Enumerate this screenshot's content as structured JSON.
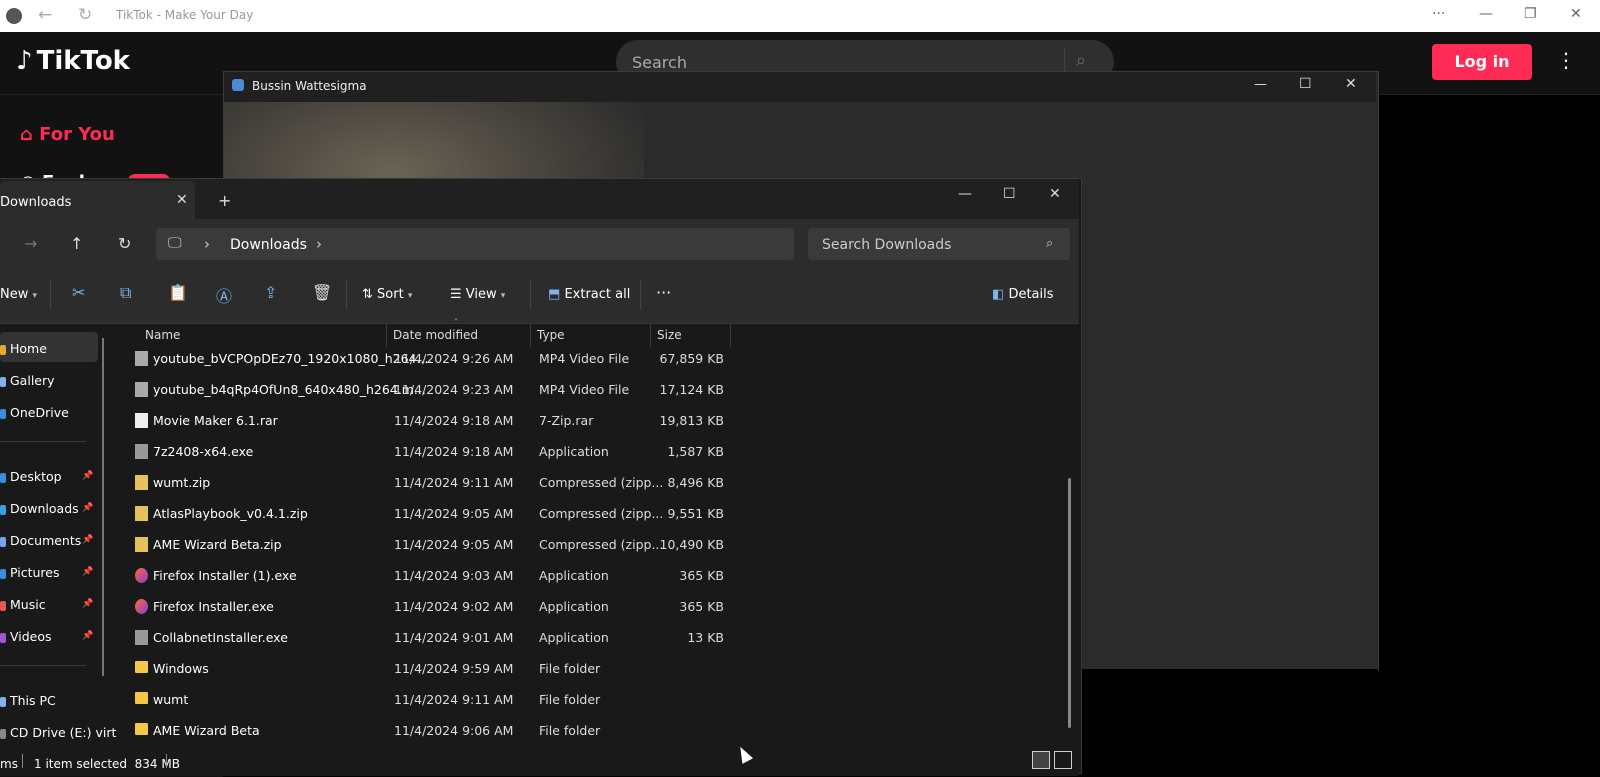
{
  "browser": {
    "title": "TikTok - Make Your Day",
    "logo_icon": "tiktok-icon",
    "back_icon": "back-arrow-icon",
    "reload_icon": "reload-icon",
    "more": "···",
    "minimize": "—",
    "restore": "❐",
    "close": "✕"
  },
  "tiktok": {
    "logo": "TikTok",
    "search_placeholder": "Search",
    "login": "Log in",
    "more": "⋮",
    "sidebar": {
      "for_you": "For You",
      "explore": "Explore"
    },
    "accent": "#fe2c55"
  },
  "video_window": {
    "title": "Bussin Wattesigma",
    "minimize": "—",
    "maximize": "☐",
    "close": "✕"
  },
  "explorer": {
    "tab_label": "Downloads",
    "tab_close": "✕",
    "tab_add": "+",
    "minimize": "—",
    "maximize": "☐",
    "close": "✕",
    "nav": {
      "forward": "→",
      "up": "↑",
      "refresh": "↻"
    },
    "address": {
      "computer_icon": "🖵",
      "sep1": "›",
      "folder": "Downloads",
      "sep2": "›"
    },
    "search_placeholder": "Search Downloads",
    "toolbar": {
      "new": "New",
      "sort": "Sort",
      "view": "View",
      "extract_all": "Extract all",
      "more": "···",
      "details": "Details"
    },
    "nav_pane": [
      {
        "label": "Home",
        "pinned": false
      },
      {
        "label": "Gallery",
        "pinned": false
      },
      {
        "label": "OneDrive",
        "pinned": false
      },
      {
        "label": "Desktop",
        "pinned": true
      },
      {
        "label": "Downloads",
        "pinned": true
      },
      {
        "label": "Documents",
        "pinned": true
      },
      {
        "label": "Pictures",
        "pinned": true
      },
      {
        "label": "Music",
        "pinned": true
      },
      {
        "label": "Videos",
        "pinned": true
      },
      {
        "label": "This PC",
        "pinned": false
      },
      {
        "label": "CD Drive (E:) virt",
        "pinned": false
      }
    ],
    "columns": {
      "name": "Name",
      "date": "Date modified",
      "type": "Type",
      "size": "Size"
    },
    "files": [
      {
        "name": "youtube_bVCPOpDEz70_1920x1080_h264....",
        "date": "11/4/2024 9:26 AM",
        "type": "MP4 Video File",
        "size": "67,859 KB",
        "icon": "vid"
      },
      {
        "name": "youtube_b4qRp4OfUn8_640x480_h264.m...",
        "date": "11/4/2024 9:23 AM",
        "type": "MP4 Video File",
        "size": "17,124 KB",
        "icon": "vid"
      },
      {
        "name": "Movie Maker 6.1.rar",
        "date": "11/4/2024 9:18 AM",
        "type": "7-Zip.rar",
        "size": "19,813 KB",
        "icon": "file"
      },
      {
        "name": "7z2408-x64.exe",
        "date": "11/4/2024 9:18 AM",
        "type": "Application",
        "size": "1,587 KB",
        "icon": "app"
      },
      {
        "name": "wumt.zip",
        "date": "11/4/2024 9:11 AM",
        "type": "Compressed (zipp...",
        "size": "8,496 KB",
        "icon": "zip"
      },
      {
        "name": "AtlasPlaybook_v0.4.1.zip",
        "date": "11/4/2024 9:05 AM",
        "type": "Compressed (zipp...",
        "size": "9,551 KB",
        "icon": "zip"
      },
      {
        "name": "AME Wizard Beta.zip",
        "date": "11/4/2024 9:05 AM",
        "type": "Compressed (zipp...",
        "size": "10,490 KB",
        "icon": "zip"
      },
      {
        "name": "Firefox Installer (1).exe",
        "date": "11/4/2024 9:03 AM",
        "type": "Application",
        "size": "365 KB",
        "icon": "ff"
      },
      {
        "name": "Firefox Installer.exe",
        "date": "11/4/2024 9:02 AM",
        "type": "Application",
        "size": "365 KB",
        "icon": "ff"
      },
      {
        "name": "CollabnetInstaller.exe",
        "date": "11/4/2024 9:01 AM",
        "type": "Application",
        "size": "13 KB",
        "icon": "app"
      },
      {
        "name": "Windows",
        "date": "11/4/2024 9:59 AM",
        "type": "File folder",
        "size": "",
        "icon": "folder"
      },
      {
        "name": "wumt",
        "date": "11/4/2024 9:11 AM",
        "type": "File folder",
        "size": "",
        "icon": "folder"
      },
      {
        "name": "AME Wizard Beta",
        "date": "11/4/2024 9:06 AM",
        "type": "File folder",
        "size": "",
        "icon": "folder"
      }
    ],
    "status": {
      "items": "ms",
      "selected": "1 item selected  834 MB"
    }
  }
}
